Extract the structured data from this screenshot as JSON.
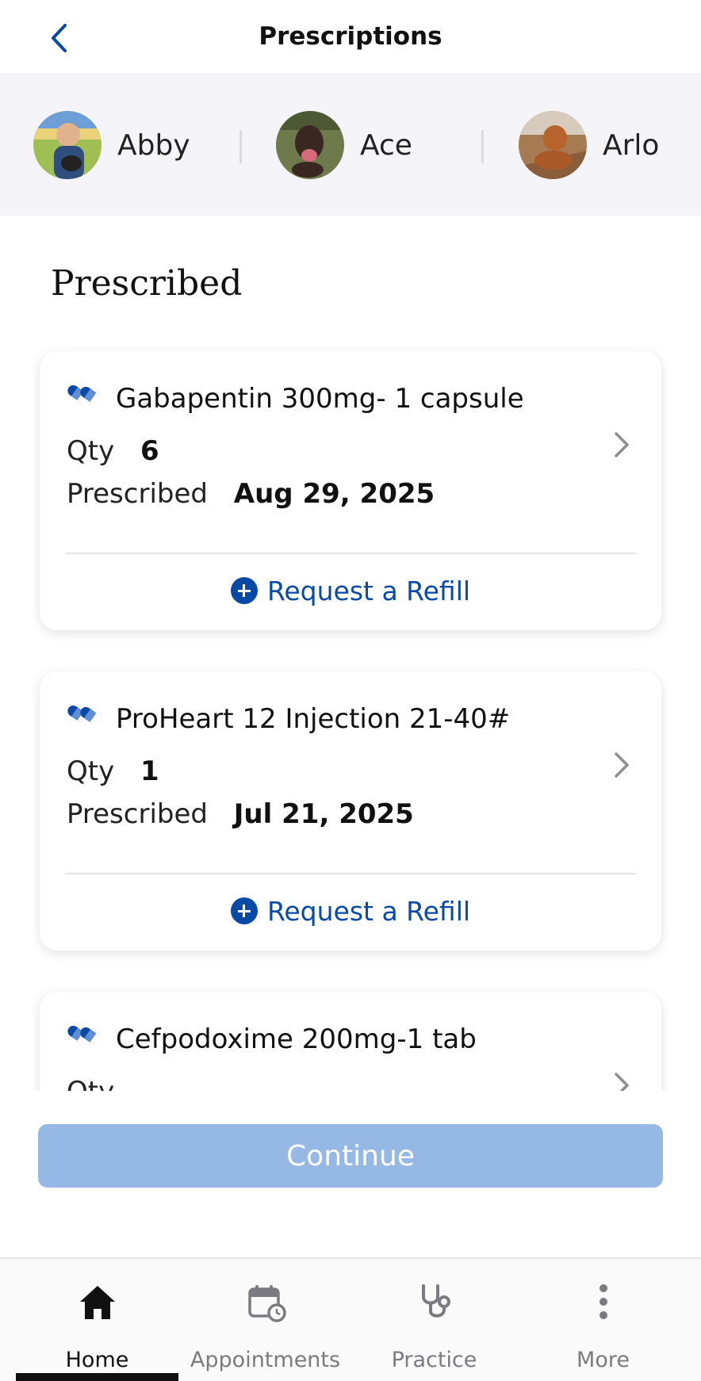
{
  "header": {
    "title": "Prescriptions",
    "back_icon": "chevron-left-icon"
  },
  "pets": [
    {
      "name": "Abby",
      "avatar": "avatar-photo"
    },
    {
      "name": "Ace",
      "avatar": "avatar-photo"
    },
    {
      "name": "Arlo",
      "avatar": "avatar-photo"
    }
  ],
  "section_title": "Prescribed",
  "prescriptions": [
    {
      "name": "Gabapentin 300mg- 1 capsule",
      "qty_label": "Qty",
      "qty": "6",
      "date_label": "Prescribed",
      "date": "Aug 29, 2025",
      "action": "Request a Refill"
    },
    {
      "name": "ProHeart 12 Injection 21-40#",
      "qty_label": "Qty",
      "qty": "1",
      "date_label": "Prescribed",
      "date": "Jul 21, 2025",
      "action": "Request a Refill"
    },
    {
      "name": "Cefpodoxime 200mg-1 tab",
      "qty_label": "Qty",
      "qty": "",
      "date_label": "",
      "date": "",
      "action": ""
    }
  ],
  "continue_label": "Continue",
  "tabs": [
    {
      "label": "Home",
      "icon": "home-icon",
      "active": true
    },
    {
      "label": "Appointments",
      "icon": "calendar-icon",
      "active": false
    },
    {
      "label": "Practice",
      "icon": "stethoscope-icon",
      "active": false
    },
    {
      "label": "More",
      "icon": "more-vertical-icon",
      "active": false
    }
  ],
  "colors": {
    "accent": "#0a4aa7",
    "continue_disabled": "#96b8e4",
    "pet_strip_bg": "#f5f4f8"
  }
}
